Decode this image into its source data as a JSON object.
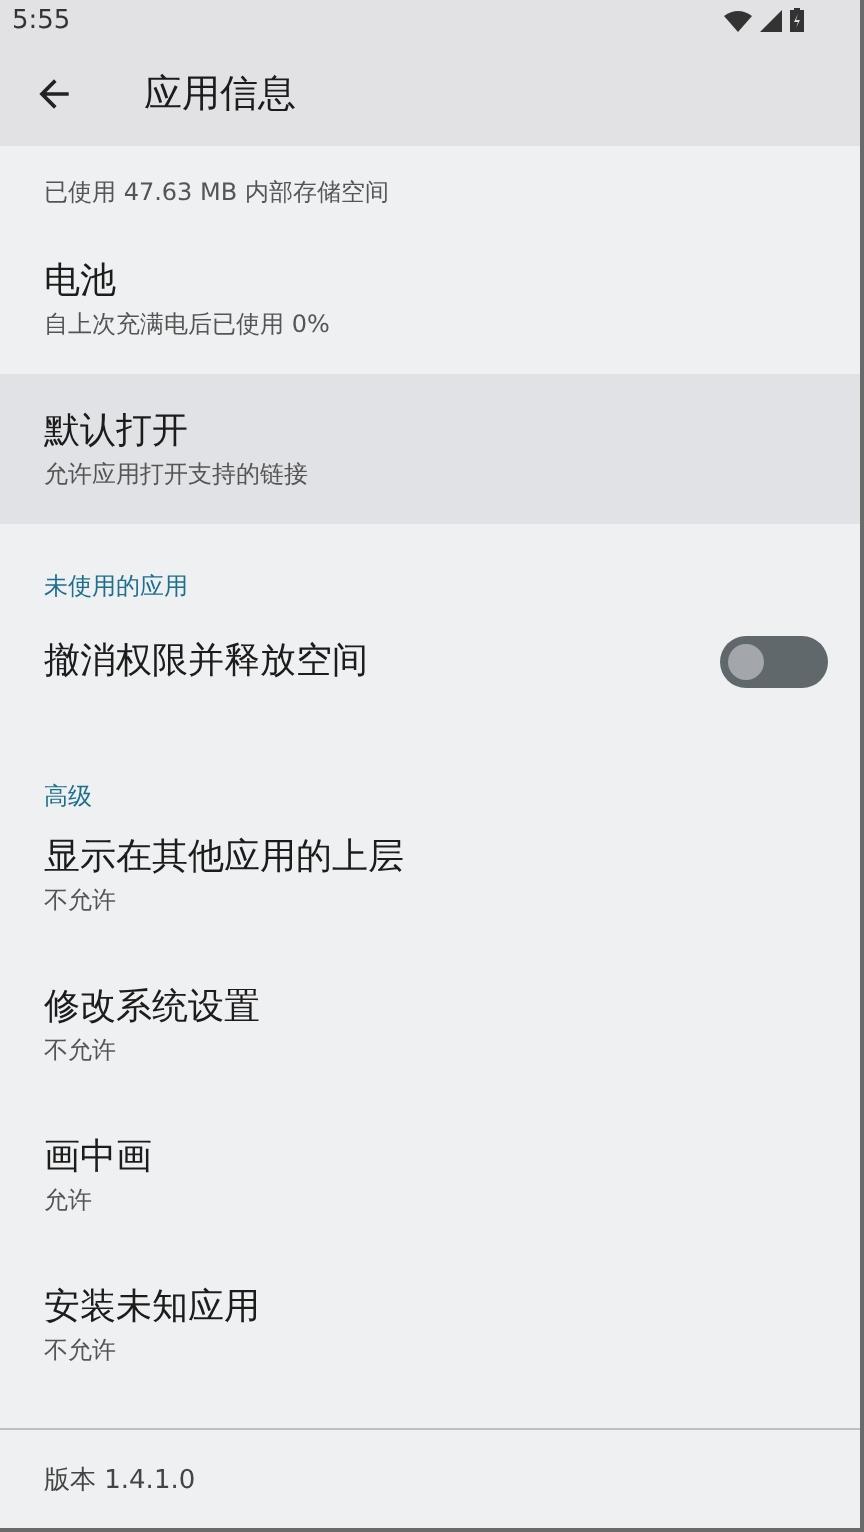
{
  "status_bar": {
    "time": "5:55"
  },
  "app_bar": {
    "title": "应用信息"
  },
  "items": [
    {
      "kind": "partial",
      "summary": "已使用 47.63 MB 内部存储空间",
      "highlighted": false
    },
    {
      "kind": "entry",
      "title": "电池",
      "summary": "自上次充满电后已使用 0%",
      "highlighted": false
    },
    {
      "kind": "entry",
      "title": "默认打开",
      "summary": "允许应用打开支持的链接",
      "highlighted": true
    },
    {
      "kind": "header",
      "title": "未使用的应用"
    },
    {
      "kind": "switch",
      "title": "撤消权限并释放空间",
      "on": false
    },
    {
      "kind": "header",
      "title": "高级"
    },
    {
      "kind": "entry",
      "title": "显示在其他应用的上层",
      "summary": "不允许",
      "highlighted": false
    },
    {
      "kind": "entry",
      "title": "修改系统设置",
      "summary": "不允许",
      "highlighted": false
    },
    {
      "kind": "entry",
      "title": "画中画",
      "summary": "允许",
      "highlighted": false
    },
    {
      "kind": "entry",
      "title": "安装未知应用",
      "summary": "不允许",
      "highlighted": false
    }
  ],
  "footer": {
    "version": "版本 1.4.1.0"
  }
}
